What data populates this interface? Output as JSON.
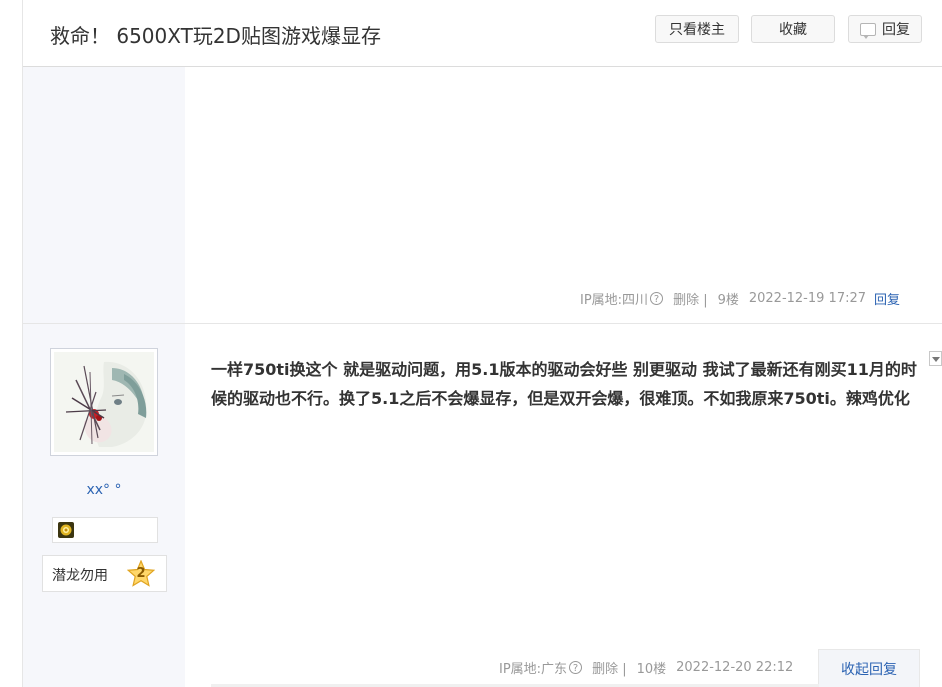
{
  "header": {
    "title": "救命！ 6500XT玩2D贴图游戏爆显存",
    "only_op_label": "只看楼主",
    "collect_label": "收藏",
    "reply_label": "回复"
  },
  "floor9": {
    "ip_location": "IP属地:四川",
    "help_icon": "?",
    "delete_label": "删除 |",
    "floor_label": "9楼",
    "time": "2022-12-19 17:27",
    "reply_label": "回复"
  },
  "floor10": {
    "user": {
      "name": "xx° °",
      "level_title": "潜龙勿用",
      "level": "2",
      "badge_icon": "gold-badge-icon"
    },
    "content": "一样750ti换这个 就是驱动问题，用5.1版本的驱动会好些 别更驱动 我试了最新还有刚买11月的时候的驱动也不行。换了5.1之后不会爆显存，但是双开会爆，很难顶。不如我原来750ti。辣鸡优化",
    "ip_location": "IP属地:广东",
    "help_icon": "?",
    "delete_label": "删除 |",
    "floor_label": "10楼",
    "time": "2022-12-20 22:12",
    "toggle_reply_label": "收起回复"
  },
  "colors": {
    "link": "#2d64b3",
    "sidebar_bg": "#f6f7fb",
    "meta_text": "#999999"
  }
}
